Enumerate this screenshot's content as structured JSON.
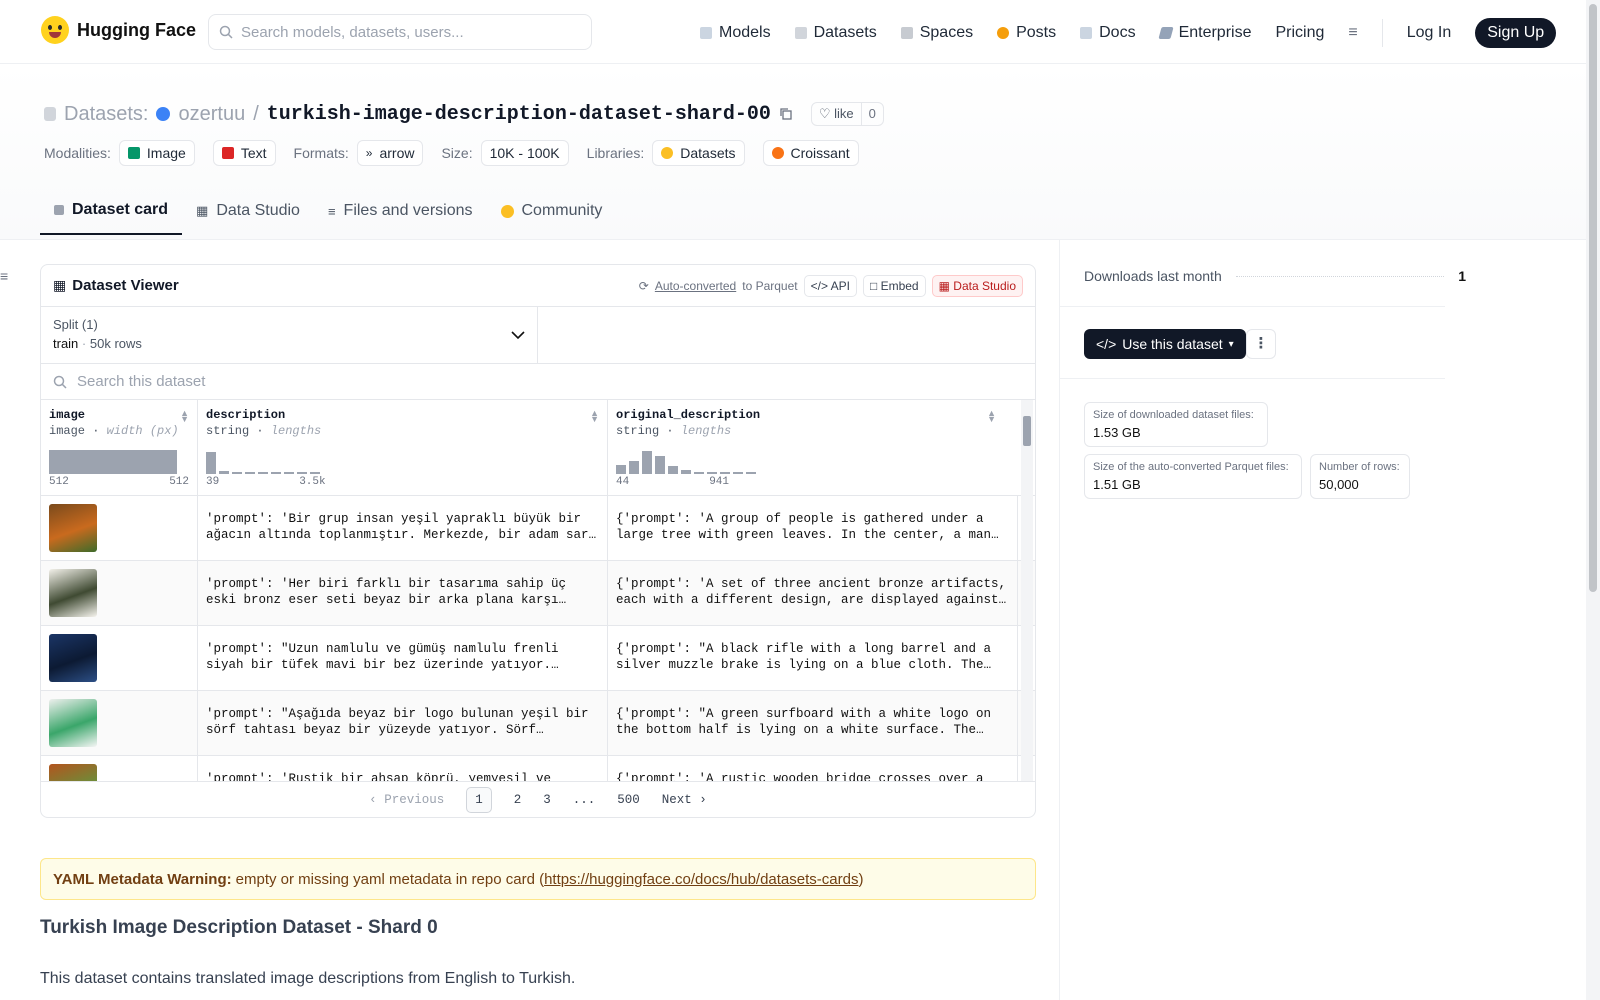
{
  "nav": {
    "brand": "Hugging Face",
    "search_placeholder": "Search models, datasets, users...",
    "links": [
      "Models",
      "Datasets",
      "Spaces",
      "Posts",
      "Docs",
      "Enterprise",
      "Pricing"
    ],
    "login": "Log In",
    "signup": "Sign Up"
  },
  "header": {
    "crumb": "Datasets:",
    "owner": "ozertuu",
    "repo": "turkish-image-description-dataset-shard-00",
    "like_label": "like",
    "like_count": "0",
    "modalities_label": "Modalities:",
    "modalities": [
      "Image",
      "Text"
    ],
    "formats_label": "Formats:",
    "format": "arrow",
    "size_label": "Size:",
    "size": "10K - 100K",
    "libraries_label": "Libraries:",
    "libraries": [
      "Datasets",
      "Croissant"
    ]
  },
  "tabs": [
    "Dataset card",
    "Data Studio",
    "Files and versions",
    "Community"
  ],
  "viewer": {
    "title": "Dataset Viewer",
    "auto_converted": "Auto-converted",
    "to_parquet": "to Parquet",
    "api": "API",
    "embed": "Embed",
    "data_studio": "Data Studio",
    "split_label": "Split (1)",
    "split_name": "train",
    "split_rows": "50k rows",
    "search_placeholder": "Search this dataset",
    "columns": [
      {
        "name": "image",
        "type": "image",
        "sub": "width (px)",
        "min": "512",
        "max": "512"
      },
      {
        "name": "description",
        "type": "string",
        "sub": "lengths",
        "min": "39",
        "max": "3.5k"
      },
      {
        "name": "original_description",
        "type": "string",
        "sub": "lengths",
        "min": "44",
        "max": "941"
      }
    ],
    "rows": [
      {
        "desc": "'prompt': 'Bir grup insan yeşil yapraklı büyük bir ağacın altında toplanmıştır. Merkezde, bir adam sarı ve turuncu bir elbise giymiş', 'category':",
        "orig": "{'prompt': 'A group of people is gathered under a large tree with green leaves. In the center, a man is wearing a yellow and orange robe'",
        "thumb": [
          "#7a4a1c",
          "#c96a1e",
          "#3d6b2a"
        ]
      },
      {
        "desc": "'prompt': 'Her biri farklı bir tasarıma sahip üç eski bronz eser seti beyaz bir arka plana karşı görüntülenir. Sol eser', 'category':",
        "orig": "{'prompt': 'A set of three ancient bronze artifacts, each with a different design, are displayed against a white background.'",
        "thumb": [
          "#f3f1ea",
          "#3f4a32",
          "#f7f5ef"
        ]
      },
      {
        "desc": "'prompt': \"Uzun namlulu ve gümüş namlulu frenli siyah bir tüfek mavi bir bez üzerinde yatıyor. Tüfeğin yan tarafında\", 'category':",
        "orig": "{'prompt': \"A black rifle with a long barrel and a silver muzzle brake is lying on a blue cloth. The rifle has a scope\"",
        "thumb": [
          "#1b3566",
          "#0c1a33",
          "#2c4f86"
        ]
      },
      {
        "desc": "'prompt': \"Aşağıda beyaz bir logo bulunan yeşil bir sörf tahtası beyaz bir yüzeyde yatıyor. Sörf tahtasının sivri ucu\", 'category':",
        "orig": "{'prompt': \"A green surfboard with a white logo on the bottom half is lying on a white surface. The surfboard is pointed\"",
        "thumb": [
          "#eef0ee",
          "#3aa66a",
          "#f6f6f6"
        ]
      },
      {
        "desc": "'prompt': 'Rustik bir ahşap köprü, yemyeşil ve sonbahar renkleriyle çevrili sakin bir derenin üzerinden geçer', 'category':",
        "orig": "{'prompt': 'A rustic wooden bridge crosses over a calm stream surrounded by lush greenery and autumn colors'",
        "thumb": [
          "#b3541e",
          "#6b8f3a",
          "#d98c3a"
        ]
      }
    ],
    "pager": {
      "prev": "Previous",
      "pages": [
        "1",
        "2",
        "3",
        "...",
        "500"
      ],
      "next": "Next"
    }
  },
  "warning": {
    "title": "YAML Metadata Warning:",
    "text": "empty or missing yaml metadata in repo card (",
    "link": "https://huggingface.co/docs/hub/datasets-cards",
    "close": ")"
  },
  "readme": {
    "heading": "Turkish Image Description Dataset - Shard 0",
    "para": "This dataset contains translated image descriptions from English to Turkish."
  },
  "side": {
    "downloads_label": "Downloads last month",
    "downloads": "1",
    "use_btn": "Use this dataset",
    "size_dl_label": "Size of downloaded dataset files:",
    "size_dl": "1.53 GB",
    "size_pq_label": "Size of the auto-converted Parquet files:",
    "size_pq": "1.51 GB",
    "rows_label": "Number of rows:",
    "rows": "50,000"
  },
  "histograms": {
    "image": [
      1.0
    ],
    "description": [
      0.85,
      0.12,
      0.08,
      0.06,
      0.05,
      0.04,
      0,
      0.04,
      0.04
    ],
    "original_description": [
      0.35,
      0.5,
      0.9,
      0.7,
      0.3,
      0.15,
      0.06,
      0.04,
      0.04,
      0.04,
      0.03
    ]
  },
  "colors": {
    "accent_dark": "#111827",
    "warning_bg": "#fefce8",
    "red_badge": "#b91c1c"
  }
}
